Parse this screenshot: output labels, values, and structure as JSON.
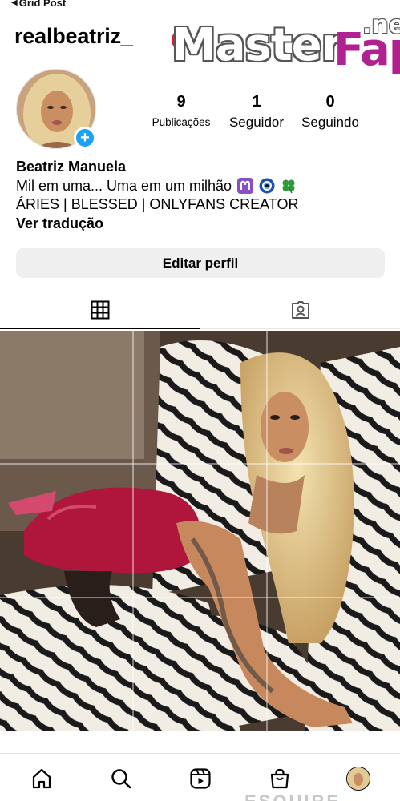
{
  "statusbar": {
    "back_label": "Grid Post"
  },
  "header": {
    "username": "realbeatriz_"
  },
  "watermark": {
    "main": "Master",
    "fap": "Fap",
    "net": ".net"
  },
  "profile": {
    "stats": [
      {
        "value": "9",
        "label": "Publicações"
      },
      {
        "value": "1",
        "label": "Seguidor"
      },
      {
        "value": "0",
        "label": "Seguindo"
      }
    ],
    "name": "Beatriz Manuela",
    "bio_line1": "Mil em uma... Uma em um milhão",
    "bio_emojis": [
      "aries-icon",
      "evil-eye-icon",
      "four-leaf-clover-icon"
    ],
    "bio_line2": "ÁRIES | BLESSED | ONLYFANS CREATOR",
    "translate_link": "Ver tradução"
  },
  "edit_button": {
    "label": "Editar perfil"
  },
  "tabs": [
    {
      "icon": "grid-icon",
      "active": true
    },
    {
      "icon": "tagged-user-icon",
      "active": false
    }
  ],
  "bottom_nav": [
    "home-icon",
    "search-icon",
    "reels-icon",
    "shop-icon",
    "profile-avatar"
  ],
  "footer_partial": "ESQUIRE",
  "colors": {
    "accent": "#1da1f2",
    "button_bg": "#efefef",
    "pink_outfit": "#b0153b"
  }
}
